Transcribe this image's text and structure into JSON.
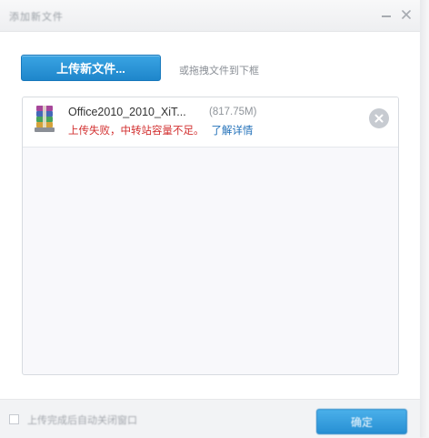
{
  "window": {
    "title": "添加新文件",
    "minimize_icon": "minimize-icon",
    "close_icon": "close-icon"
  },
  "toolbar": {
    "upload_label": "上传新文件...",
    "drag_hint": "或拖拽文件到下框"
  },
  "files": [
    {
      "name": "Office2010_2010_XiT...",
      "size": "(817.75M)",
      "status": "上传失败，中转站容量不足。",
      "details_link": "了解详情",
      "icon": "winrar-archive-icon",
      "remove_icon": "remove-x-icon"
    }
  ],
  "footer": {
    "checkbox_label": "上传完成后自动关闭窗口",
    "action_label": "确定"
  },
  "colors": {
    "accent": "#2b93d6",
    "error": "#d22f2f",
    "link": "#1f6fb8"
  }
}
